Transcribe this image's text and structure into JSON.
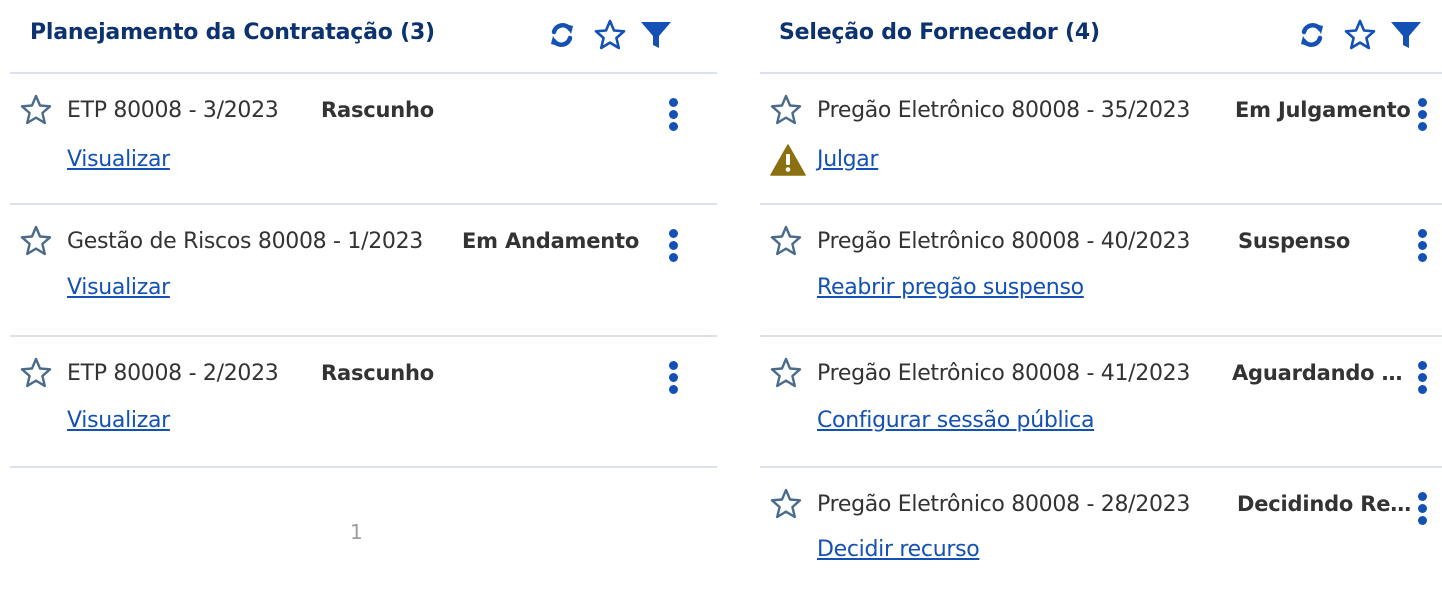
{
  "panels": [
    {
      "title": "Planejamento da Contratação (3)",
      "items": [
        {
          "name": "ETP 80008 - 3/2023",
          "status": "Rascunho",
          "action": "Visualizar"
        },
        {
          "name": "Gestão de Riscos 80008 - 1/2023",
          "status": "Em Andamento",
          "action": "Visualizar"
        },
        {
          "name": "ETP 80008 - 2/2023",
          "status": "Rascunho",
          "action": "Visualizar"
        }
      ],
      "pagination": {
        "current_page": "1"
      }
    },
    {
      "title": "Seleção do Fornecedor (4)",
      "items": [
        {
          "name": "Pregão Eletrônico 80008 - 35/2023",
          "status": "Em Julgamento",
          "action": "Julgar",
          "warning_icon": "warning-triangle-icon"
        },
        {
          "name": "Pregão Eletrônico 80008 - 40/2023",
          "status": "Suspenso",
          "action": "Reabrir pregão suspenso"
        },
        {
          "name": "Pregão Eletrônico 80008 - 41/2023",
          "status": "Aguardando A...",
          "action": "Configurar sessão pública"
        },
        {
          "name": "Pregão Eletrônico 80008 - 28/2023",
          "status": "Decidindo Rec...",
          "action": "Decidir recurso"
        }
      ]
    }
  ],
  "icons": {
    "header": [
      "refresh-icon",
      "star-outline-icon",
      "filter-icon"
    ],
    "item": [
      "star-outline-icon",
      "kebab-menu-icon"
    ]
  },
  "colors": {
    "title": "#0c326f",
    "primary": "#1351b4",
    "text": "#333333",
    "divider": "#dbe1ea",
    "star_outline": "#4a6b8a",
    "warning": "#8a7010",
    "pagination": "#9e9e9e"
  }
}
